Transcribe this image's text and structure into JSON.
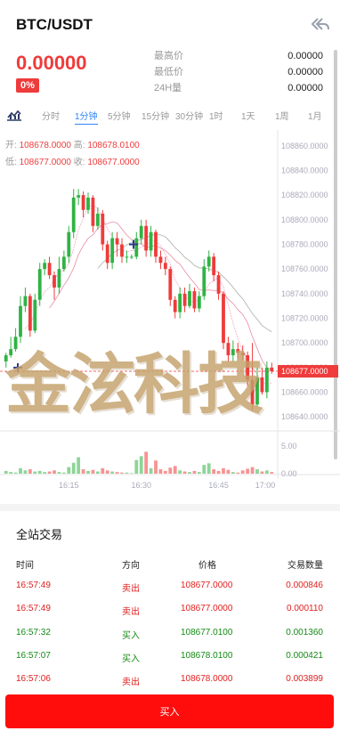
{
  "header": {
    "title": "BTC/USDT",
    "back_icon": "double-back-arrow-icon"
  },
  "ticker": {
    "price": "0.00000",
    "change": "0%",
    "stats": [
      {
        "label": "最高价",
        "value": "0.00000"
      },
      {
        "label": "最低价",
        "value": "0.00000"
      },
      {
        "label": "24H量",
        "value": "0.00000"
      }
    ]
  },
  "timeframes": [
    "分时",
    "1分钟",
    "5分钟",
    "15分钟",
    "30分钟",
    "1时",
    "1天",
    "1周",
    "1月"
  ],
  "active_timeframe": "1分钟",
  "ohlc": {
    "open_label": "开:",
    "open": "108678.0000",
    "high_label": "高:",
    "high": "108678.0100",
    "low_label": "低:",
    "low": "108677.0000",
    "close_label": "收:",
    "close": "108677.0000"
  },
  "watermark_text": "金泫科技",
  "colors": {
    "up": "#2fb344",
    "down": "#ef3b3b",
    "accent": "#2f86f6",
    "buy": "#ff0d0d"
  },
  "chart_data": {
    "type": "candlestick",
    "y_axis_ticks": [
      "108860.0000",
      "108840.0000",
      "108820.0000",
      "108800.0000",
      "108780.0000",
      "108760.0000",
      "108740.0000",
      "108720.0000",
      "108700.0000",
      "108680.0000",
      "108660.0000",
      "108640.0000"
    ],
    "ylim": [
      108630,
      108870
    ],
    "last_price": "108677.0000",
    "x_ticks": [
      "16:15",
      "16:30",
      "16:45",
      "17:00"
    ],
    "volume_ticks": [
      "5.00",
      "0.00"
    ],
    "volume_ylim": [
      0,
      6.5
    ],
    "candles": [
      {
        "o": 108685,
        "c": 108690,
        "h": 108692,
        "l": 108680,
        "v": 0.5
      },
      {
        "o": 108690,
        "c": 108695,
        "h": 108705,
        "l": 108688,
        "v": 0.3
      },
      {
        "o": 108695,
        "c": 108705,
        "h": 108712,
        "l": 108693,
        "v": 0.2
      },
      {
        "o": 108705,
        "c": 108730,
        "h": 108738,
        "l": 108700,
        "v": 1.0
      },
      {
        "o": 108730,
        "c": 108738,
        "h": 108745,
        "l": 108725,
        "v": 0.6
      },
      {
        "o": 108738,
        "c": 108710,
        "h": 108740,
        "l": 108705,
        "v": 0.8
      },
      {
        "o": 108710,
        "c": 108735,
        "h": 108740,
        "l": 108708,
        "v": 0.4
      },
      {
        "o": 108735,
        "c": 108760,
        "h": 108765,
        "l": 108730,
        "v": 0.5
      },
      {
        "o": 108760,
        "c": 108765,
        "h": 108768,
        "l": 108755,
        "v": 0.3
      },
      {
        "o": 108765,
        "c": 108755,
        "h": 108770,
        "l": 108752,
        "v": 0.4
      },
      {
        "o": 108755,
        "c": 108745,
        "h": 108758,
        "l": 108735,
        "v": 0.6
      },
      {
        "o": 108745,
        "c": 108760,
        "h": 108770,
        "l": 108740,
        "v": 0.3
      },
      {
        "o": 108760,
        "c": 108770,
        "h": 108775,
        "l": 108758,
        "v": 0.2
      },
      {
        "o": 108770,
        "c": 108790,
        "h": 108795,
        "l": 108765,
        "v": 1.2
      },
      {
        "o": 108790,
        "c": 108818,
        "h": 108825,
        "l": 108785,
        "v": 2.0
      },
      {
        "o": 108818,
        "c": 108820,
        "h": 108825,
        "l": 108812,
        "v": 3.0
      },
      {
        "o": 108820,
        "c": 108808,
        "h": 108823,
        "l": 108802,
        "v": 0.8
      },
      {
        "o": 108808,
        "c": 108818,
        "h": 108822,
        "l": 108805,
        "v": 0.5
      },
      {
        "o": 108818,
        "c": 108795,
        "h": 108820,
        "l": 108790,
        "v": 0.7
      },
      {
        "o": 108795,
        "c": 108805,
        "h": 108810,
        "l": 108792,
        "v": 0.4
      },
      {
        "o": 108805,
        "c": 108780,
        "h": 108808,
        "l": 108775,
        "v": 1.0
      },
      {
        "o": 108780,
        "c": 108765,
        "h": 108783,
        "l": 108760,
        "v": 0.6
      },
      {
        "o": 108765,
        "c": 108785,
        "h": 108790,
        "l": 108760,
        "v": 0.4
      },
      {
        "o": 108785,
        "c": 108780,
        "h": 108790,
        "l": 108770,
        "v": 0.3
      },
      {
        "o": 108780,
        "c": 108770,
        "h": 108785,
        "l": 108765,
        "v": 0.2
      },
      {
        "o": 108770,
        "c": 108770,
        "h": 108775,
        "l": 108765,
        "v": 0.2
      },
      {
        "o": 108770,
        "c": 108770,
        "h": 108772,
        "l": 108768,
        "v": 0.1
      },
      {
        "o": 108770,
        "c": 108785,
        "h": 108790,
        "l": 108768,
        "v": 2.5
      },
      {
        "o": 108785,
        "c": 108795,
        "h": 108800,
        "l": 108780,
        "v": 3.2
      },
      {
        "o": 108795,
        "c": 108775,
        "h": 108800,
        "l": 108770,
        "v": 4.0
      },
      {
        "o": 108775,
        "c": 108790,
        "h": 108795,
        "l": 108770,
        "v": 1.0
      },
      {
        "o": 108790,
        "c": 108770,
        "h": 108792,
        "l": 108765,
        "v": 2.4
      },
      {
        "o": 108770,
        "c": 108765,
        "h": 108775,
        "l": 108760,
        "v": 0.8
      },
      {
        "o": 108765,
        "c": 108760,
        "h": 108770,
        "l": 108755,
        "v": 0.5
      },
      {
        "o": 108760,
        "c": 108735,
        "h": 108762,
        "l": 108730,
        "v": 1.1
      },
      {
        "o": 108735,
        "c": 108725,
        "h": 108738,
        "l": 108720,
        "v": 1.4
      },
      {
        "o": 108725,
        "c": 108740,
        "h": 108745,
        "l": 108720,
        "v": 0.6
      },
      {
        "o": 108740,
        "c": 108730,
        "h": 108745,
        "l": 108725,
        "v": 0.4
      },
      {
        "o": 108730,
        "c": 108742,
        "h": 108748,
        "l": 108728,
        "v": 0.3
      },
      {
        "o": 108742,
        "c": 108728,
        "h": 108745,
        "l": 108725,
        "v": 0.5
      },
      {
        "o": 108728,
        "c": 108738,
        "h": 108742,
        "l": 108725,
        "v": 0.3
      },
      {
        "o": 108738,
        "c": 108762,
        "h": 108768,
        "l": 108735,
        "v": 1.6
      },
      {
        "o": 108762,
        "c": 108770,
        "h": 108775,
        "l": 108758,
        "v": 1.9
      },
      {
        "o": 108770,
        "c": 108755,
        "h": 108773,
        "l": 108750,
        "v": 0.8
      },
      {
        "o": 108755,
        "c": 108740,
        "h": 108758,
        "l": 108735,
        "v": 0.5
      },
      {
        "o": 108740,
        "c": 108700,
        "h": 108742,
        "l": 108695,
        "v": 1.0
      },
      {
        "o": 108700,
        "c": 108690,
        "h": 108705,
        "l": 108685,
        "v": 0.7
      },
      {
        "o": 108690,
        "c": 108695,
        "h": 108702,
        "l": 108685,
        "v": 0.3
      },
      {
        "o": 108695,
        "c": 108692,
        "h": 108700,
        "l": 108688,
        "v": 0.2
      },
      {
        "o": 108692,
        "c": 108690,
        "h": 108698,
        "l": 108686,
        "v": 0.6
      },
      {
        "o": 108690,
        "c": 108670,
        "h": 108693,
        "l": 108665,
        "v": 0.9
      },
      {
        "o": 108670,
        "c": 108650,
        "h": 108700,
        "l": 108645,
        "v": 1.2
      },
      {
        "o": 108650,
        "c": 108672,
        "h": 108680,
        "l": 108648,
        "v": 0.8
      },
      {
        "o": 108672,
        "c": 108660,
        "h": 108680,
        "l": 108658,
        "v": 0.4
      },
      {
        "o": 108660,
        "c": 108680,
        "h": 108685,
        "l": 108655,
        "v": 0.6
      },
      {
        "o": 108680,
        "c": 108677,
        "h": 108684,
        "l": 108675,
        "v": 0.3
      }
    ]
  },
  "trades": {
    "title": "全站交易",
    "headers": {
      "time": "时间",
      "direction": "方向",
      "price": "价格",
      "qty": "交易数量"
    },
    "rows": [
      {
        "time": "16:57:49",
        "dir": "卖出",
        "side": "sell",
        "price": "108677.0000",
        "qty": "0.000846"
      },
      {
        "time": "16:57:49",
        "dir": "卖出",
        "side": "sell",
        "price": "108677.0000",
        "qty": "0.000110"
      },
      {
        "time": "16:57:32",
        "dir": "买入",
        "side": "buy",
        "price": "108677.0100",
        "qty": "0.001360"
      },
      {
        "time": "16:57:07",
        "dir": "买入",
        "side": "buy",
        "price": "108678.0100",
        "qty": "0.000421"
      },
      {
        "time": "16:57:06",
        "dir": "卖出",
        "side": "sell",
        "price": "108678.0000",
        "qty": "0.003899"
      }
    ]
  },
  "buy_button_label": "买入"
}
